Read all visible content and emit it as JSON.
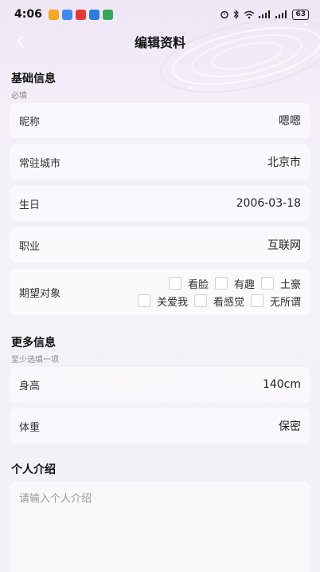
{
  "status_bar": {
    "time": "4:06",
    "battery": "63",
    "app_icon_colors": [
      "#f5a623",
      "#3d8af7",
      "#e53935",
      "#2a7de1",
      "#3aa657"
    ]
  },
  "nav": {
    "title": "编辑资料"
  },
  "basic": {
    "title": "基础信息",
    "subtitle": "必填",
    "nickname": {
      "label": "昵称",
      "value": "嗯嗯"
    },
    "city": {
      "label": "常驻城市",
      "value": "北京市"
    },
    "birthday": {
      "label": "生日",
      "value": "2006-03-18"
    },
    "job": {
      "label": "职业",
      "value": "互联网"
    },
    "expect": {
      "label": "期望对象",
      "row1": [
        "看脸",
        "有趣",
        "土豪"
      ],
      "row2": [
        "关爱我",
        "看感觉",
        "无所谓"
      ]
    }
  },
  "more": {
    "title": "更多信息",
    "subtitle": "至少选填一项",
    "height": {
      "label": "身高",
      "value": "140cm"
    },
    "weight": {
      "label": "体重",
      "value": "保密"
    }
  },
  "intro": {
    "title": "个人介绍",
    "placeholder": "请输入个人介绍"
  }
}
